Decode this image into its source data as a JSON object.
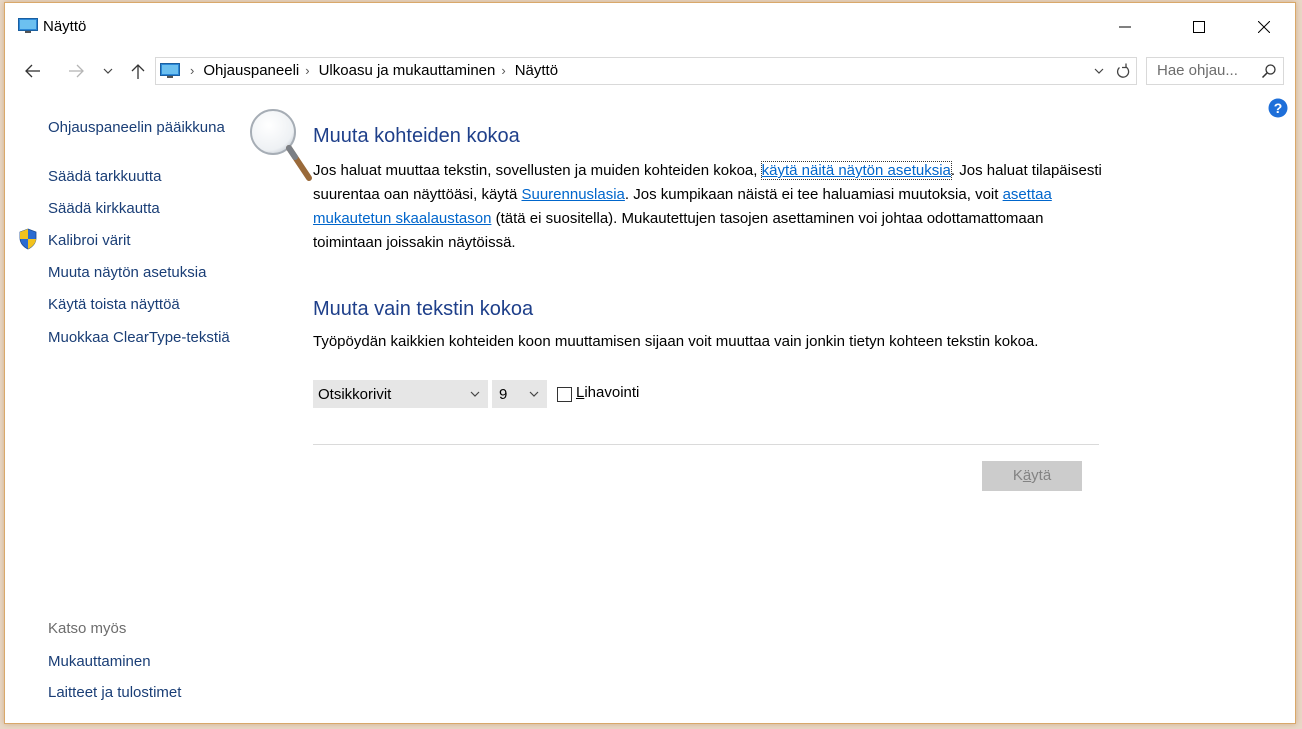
{
  "window": {
    "title": "Näyttö",
    "controls": {
      "minimize": "minimize",
      "maximize": "maximize",
      "close": "close"
    }
  },
  "nav": {
    "breadcrumbs": [
      "Ohjauspaneeli",
      "Ulkoasu ja mukauttaminen",
      "Näyttö"
    ],
    "search_placeholder": "Hae ohjau..."
  },
  "sidebar": {
    "items": [
      "Ohjauspaneelin pääikkuna",
      "Säädä tarkkuutta",
      "Säädä kirkkautta",
      "Kalibroi värit",
      "Muuta näytön asetuksia",
      "Käytä toista näyttöä",
      "Muokkaa ClearType-tekstiä"
    ],
    "see_also_heading": "Katso myös",
    "see_also": [
      "Mukauttaminen",
      "Laitteet ja tulostimet"
    ]
  },
  "section1": {
    "heading": "Muuta kohteiden kokoa",
    "t1": "Jos haluat muuttaa tekstin, sovellusten ja muiden kohteiden kokoa, ",
    "link1": "käytä näitä näytön asetuksia",
    "t2": ". Jos haluat tilapäisesti suurentaa oan näyttöäsi, käytä ",
    "link2": "Suurennuslasia",
    "t3": ". Jos kumpikaan näistä ei tee haluamiasi muutoksia, voit ",
    "link3": "asettaa mukautetun skaalaustason",
    "t4": " (tätä ei suositella). Mukautettujen tasojen asettaminen voi johtaa odottamattomaan toimintaan joissakin näytöissä."
  },
  "section2": {
    "heading": "Muuta vain tekstin kokoa",
    "description": "Työpöydän kaikkien kohteiden koon muuttamisen sijaan voit muuttaa vain jonkin tietyn kohteen tekstin kokoa.",
    "item_select": "Otsikkorivit",
    "size_select": "9",
    "bold_label_accel": "L",
    "bold_label_rest": "ihavointi",
    "bold_checked": false
  },
  "apply": {
    "prefix": "K",
    "accel": "ä",
    "suffix": "ytä"
  },
  "colors": {
    "heading": "#1e3f8a",
    "link": "#0066cc",
    "sidebar_link": "#1a3e76"
  }
}
